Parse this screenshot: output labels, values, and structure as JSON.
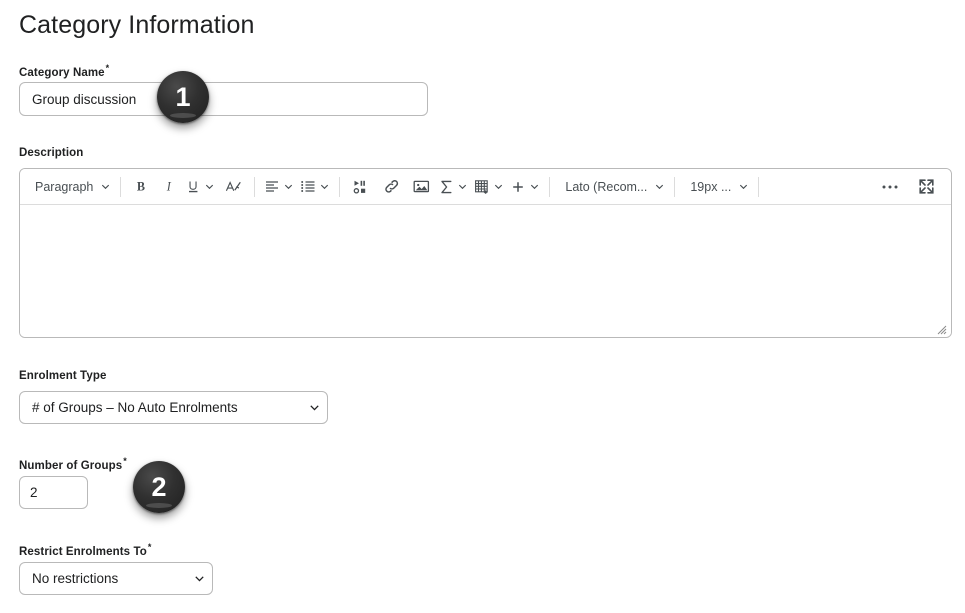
{
  "page": {
    "title": "Category Information"
  },
  "fields": {
    "category_name": {
      "label": "Category Name",
      "required_marker": "*",
      "value": "Group discussion",
      "placeholder": ""
    },
    "description": {
      "label": "Description",
      "value": "",
      "placeholder": ""
    },
    "enrolment_type": {
      "label": "Enrolment Type",
      "selected": "# of Groups – No Auto Enrolments"
    },
    "number_of_groups": {
      "label": "Number of Groups",
      "required_marker": "*",
      "value": "2"
    },
    "restrict_enrolments_to": {
      "label": "Restrict Enrolments To",
      "required_marker": "*",
      "selected": "No restrictions"
    }
  },
  "editor_toolbar": {
    "paragraph_style": "Paragraph",
    "font_family": "Lato (Recom...",
    "font_size": "19px ...",
    "buttons": [
      {
        "name": "paragraph-format",
        "label": "Paragraph"
      },
      {
        "name": "bold",
        "label": "B"
      },
      {
        "name": "italic",
        "label": "I"
      },
      {
        "name": "underline",
        "label": "U"
      },
      {
        "name": "text-style",
        "label": "A"
      },
      {
        "name": "align",
        "label": "Align"
      },
      {
        "name": "list",
        "label": "List"
      },
      {
        "name": "insert-media",
        "label": "Insert Stuff"
      },
      {
        "name": "insert-link",
        "label": "Insert Link"
      },
      {
        "name": "insert-image",
        "label": "Insert Image"
      },
      {
        "name": "equation",
        "label": "Equation"
      },
      {
        "name": "table",
        "label": "Table"
      },
      {
        "name": "insert",
        "label": "Insert"
      },
      {
        "name": "more-options",
        "label": "..."
      },
      {
        "name": "fullscreen",
        "label": "Fullscreen"
      }
    ]
  },
  "annotations": {
    "badges": [
      {
        "number": "1",
        "target": "category-name-input"
      },
      {
        "number": "2",
        "target": "number-of-groups-input"
      }
    ]
  },
  "colors": {
    "text": "#202122",
    "border": "#b9b9b9",
    "toolbar_icon": "#494f53",
    "badge_bg": "#2b2b2b",
    "badge_text": "#ffffff"
  }
}
